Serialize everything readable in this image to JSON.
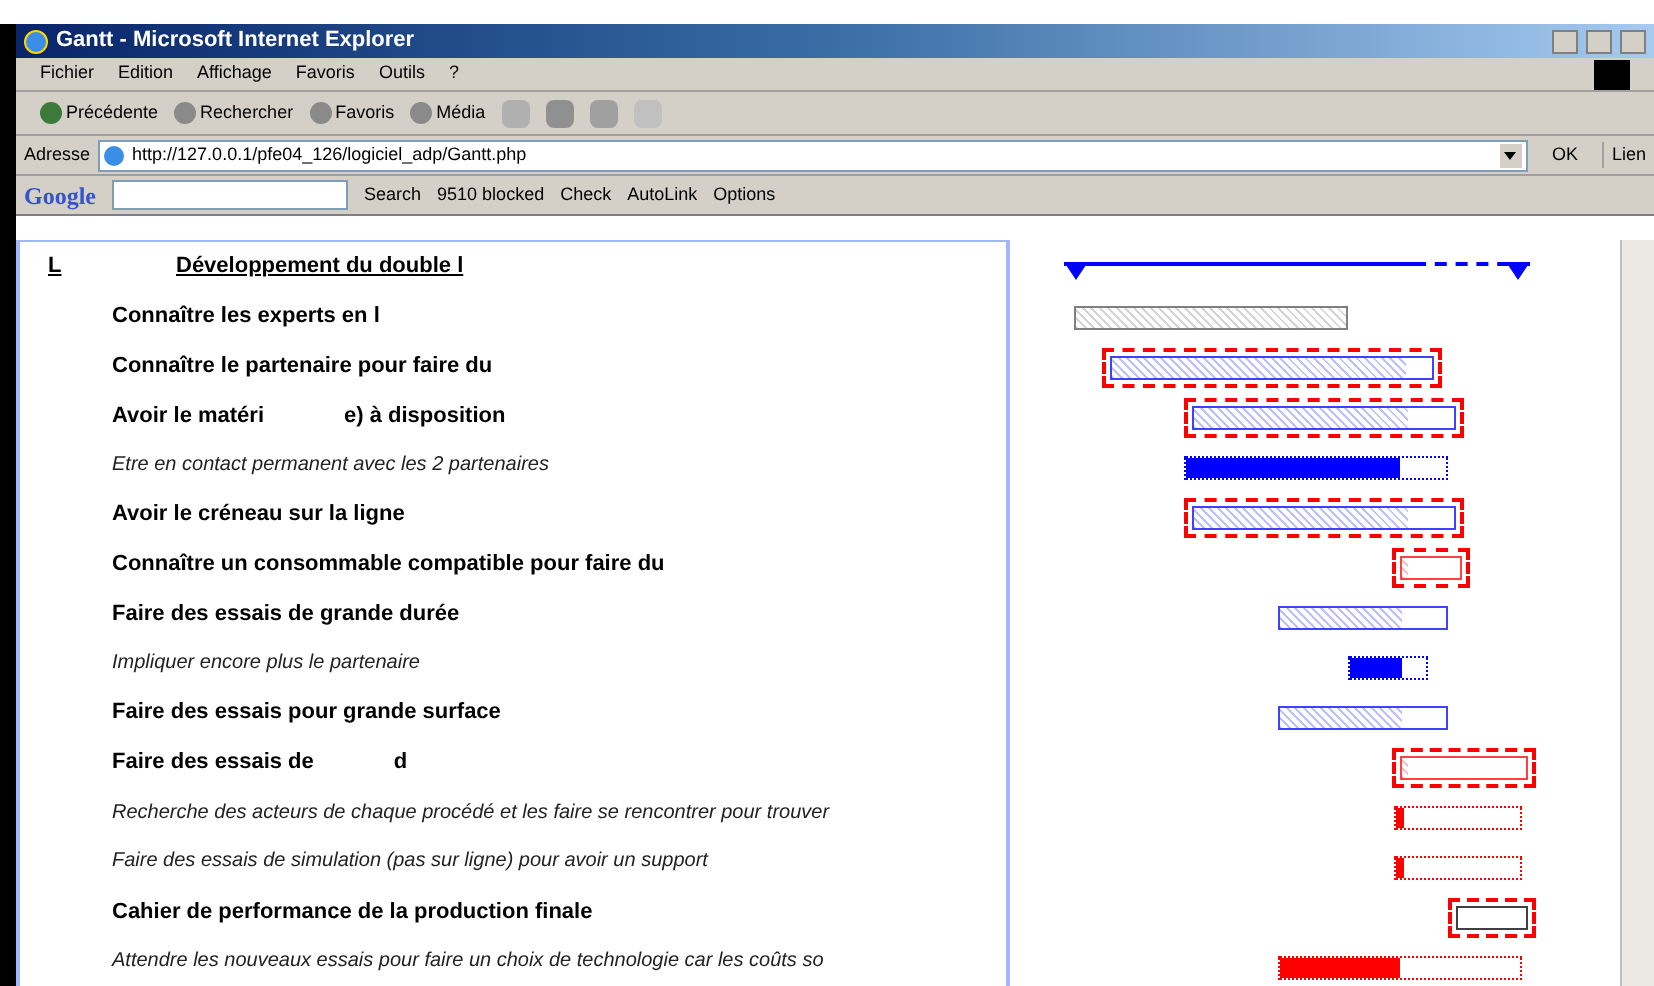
{
  "window": {
    "title": "Gantt - Microsoft Internet Explorer"
  },
  "menu": [
    "Fichier",
    "Edition",
    "Affichage",
    "Favoris",
    "Outils",
    "?"
  ],
  "toolbar": [
    {
      "kind": "back",
      "label": "Précédente"
    },
    {
      "kind": "search",
      "label": "Rechercher"
    },
    {
      "kind": "favorites",
      "label": "Favoris"
    },
    {
      "kind": "media",
      "label": "Média"
    }
  ],
  "address": {
    "label": "Adresse",
    "value": "http://127.0.0.1/pfe04_126/logiciel_adp/Gantt.php",
    "go": "OK",
    "links": "Lien"
  },
  "google_bar": {
    "logo": "Google",
    "search": "Search",
    "blocked": "9510 blocked",
    "check": "Check",
    "autolink": "AutoLink",
    "options": "Options"
  },
  "summary": {
    "code": "L",
    "label": "Développement du double l",
    "level": 0.75
  },
  "tasks": [
    {
      "kind": "task",
      "label": "Connaître les experts en l",
      "bar": {
        "kind": "hatched",
        "color": "#808080",
        "critical": false,
        "level": 1
      }
    },
    {
      "kind": "task",
      "label": "Connaître le partenaire pour faire du",
      "bar": {
        "kind": "hatched",
        "color": "#4040ff",
        "critical": true,
        "level": 0.92
      }
    },
    {
      "kind": "task",
      "label": "Avoir le matéri",
      "label_2": "e) à disposition",
      "bar": {
        "kind": "hatched",
        "color": "#4040ff",
        "critical": true,
        "level": 0.82
      }
    },
    {
      "kind": "subtask",
      "label": "Etre en contact permanent avec les 2 partenaires",
      "bar": {
        "kind": "solid",
        "color": "#0000ff",
        "critical": false,
        "level": 0.82
      }
    },
    {
      "kind": "task",
      "label": "Avoir le créneau sur la ligne",
      "bar": {
        "kind": "hatched",
        "color": "#4040ff",
        "critical": true,
        "level": 0.82
      }
    },
    {
      "kind": "task",
      "label": "Connaître un consommable compatible pour faire du",
      "bar": {
        "kind": "hatched",
        "color": "#ff4040",
        "critical": true,
        "level": 0.1
      }
    },
    {
      "kind": "task",
      "label": "Faire des essais de grande durée",
      "bar": {
        "kind": "hatched",
        "color": "#4040ff",
        "critical": false,
        "level": 0.73
      }
    },
    {
      "kind": "subtask",
      "label": "Impliquer encore plus le partenaire",
      "bar": {
        "kind": "solid",
        "color": "#0000ff",
        "critical": false,
        "level": 0.68
      }
    },
    {
      "kind": "task",
      "label": "Faire des essais pour grande surface",
      "bar": {
        "kind": "hatched",
        "color": "#4040ff",
        "critical": false,
        "level": 0.73
      }
    },
    {
      "kind": "task",
      "label": "Faire des essais de",
      "label_2": "d",
      "bar": {
        "kind": "hatched",
        "color": "#ff4040",
        "critical": true,
        "level": 0.05
      }
    },
    {
      "kind": "subtask",
      "label": "Recherche des acteurs de chaque procédé et les faire se rencontrer pour trouver",
      "bar": {
        "kind": "solid",
        "color": "#ff0000",
        "critical": false,
        "level": 0.06
      }
    },
    {
      "kind": "subtask",
      "label": "Faire des essais de simulation (pas sur ligne) pour avoir un support",
      "bar": {
        "kind": "solid",
        "color": "#ff0000",
        "critical": false,
        "level": 0.06
      }
    },
    {
      "kind": "task",
      "label": "Cahier de performance de la production finale",
      "bar": {
        "kind": "hatched",
        "color": "#404040",
        "critical": true
      }
    },
    {
      "kind": "subtask",
      "label": "Attendre les nouveaux essais pour faire un choix de technologie car les coûts so",
      "bar": {
        "kind": "solid",
        "color": "#ff0000",
        "critical": false,
        "level": 0.5
      }
    }
  ]
}
